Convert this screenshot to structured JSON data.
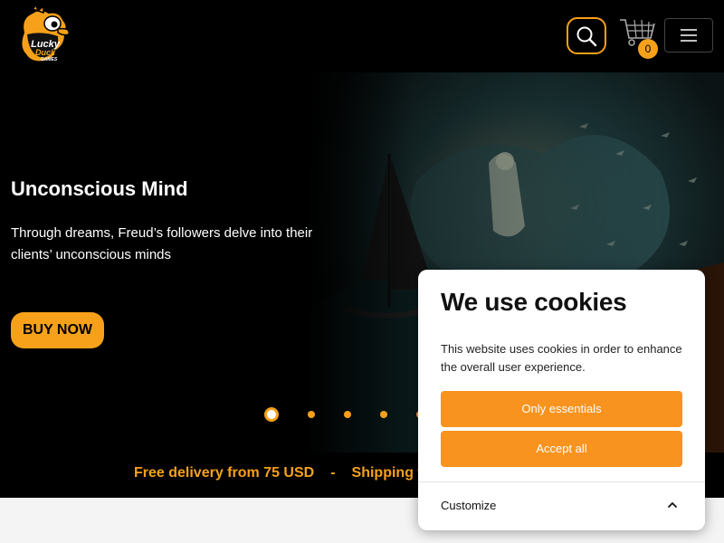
{
  "header": {
    "logo": {
      "line1": "Lucky",
      "line2": "Duck",
      "line3": "GAMES",
      "icon": "duck-logo-icon"
    },
    "search_icon": "search-icon",
    "cart": {
      "icon": "cart-icon",
      "count": "0"
    },
    "menu_icon": "hamburger-menu-icon"
  },
  "hero": {
    "title": "Unconscious Mind",
    "description": "Through dreams, Freud’s followers delve into their clients’ unconscious minds",
    "cta_label": "BUY NOW",
    "carousel": {
      "total_slides": 5,
      "active_index": 0
    }
  },
  "delivery_bar": {
    "items": [
      "Free delivery from 75 USD",
      "-",
      "Shipping w"
    ]
  },
  "cookie_banner": {
    "title": "We use cookies",
    "text": "This website uses cookies in order to enhance the overall user experience.",
    "essentials_label": "Only essentials",
    "accept_label": "Accept all",
    "customize_label": "Customize",
    "customize_icon": "chevron-up-icon"
  },
  "colors": {
    "accent": "#f7a11a",
    "cookie_button": "#f7931e",
    "background": "#000000",
    "text": "#ffffff"
  }
}
